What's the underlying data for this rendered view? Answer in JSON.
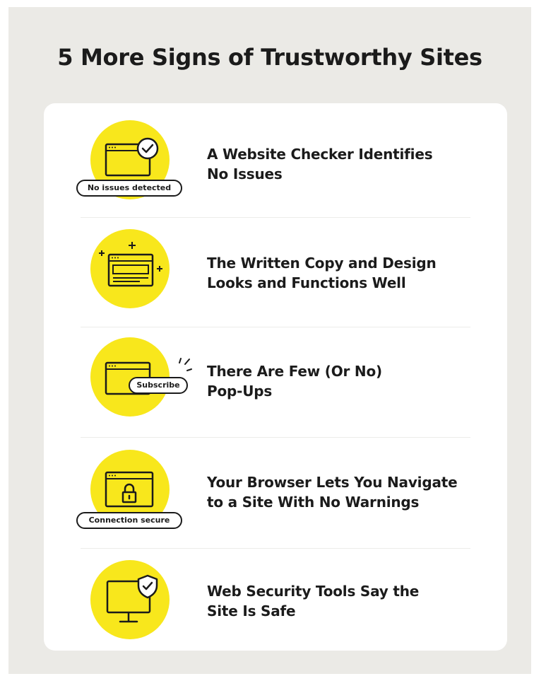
{
  "title": "5 More Signs of Trustworthy Sites",
  "colors": {
    "background": "#ebeae6",
    "card": "#ffffff",
    "accent": "#f8e71c",
    "ink": "#1b1b1b"
  },
  "items": [
    {
      "icon": "browser-checkmark-icon",
      "lines": [
        "A Website Checker Identifies",
        "No Issues"
      ],
      "badge": "No issues detected"
    },
    {
      "icon": "browser-sparkle-icon",
      "lines": [
        "The Written Copy and Design",
        "Looks and Functions Well"
      ]
    },
    {
      "icon": "browser-popup-icon",
      "lines": [
        "There Are Few (Or No)",
        "Pop-Ups"
      ],
      "badge": "Subscribe"
    },
    {
      "icon": "browser-lock-icon",
      "lines": [
        "Your Browser Lets You Navigate",
        "to a Site With No Warnings"
      ],
      "badge": "Connection secure"
    },
    {
      "icon": "monitor-shield-icon",
      "lines": [
        "Web Security Tools Say the",
        "Site Is Safe"
      ]
    }
  ]
}
